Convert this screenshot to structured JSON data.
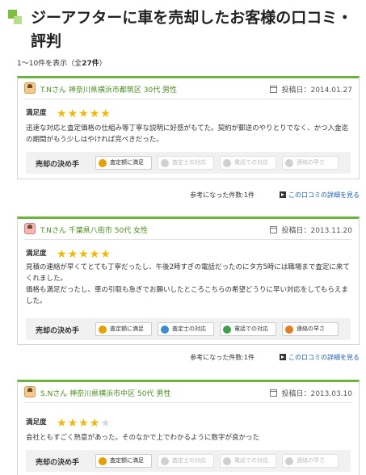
{
  "page": {
    "title": "ジーアフターに車を売却したお客様の口コミ・評判",
    "result_prefix": "1〜10件を表示（全",
    "result_total": "27件",
    "result_suffix": "）"
  },
  "labels": {
    "satisfaction": "満足度",
    "decider_title": "売却の決め手",
    "chip_price": "査定額に満足",
    "chip_staff": "査定士の対応",
    "chip_phone": "電話での対応",
    "chip_contact": "連絡の早さ",
    "helpful_prefix": "参考になった件数:",
    "detail_link": "この口コミの詳細を見る"
  },
  "reviews": [
    {
      "reviewer": "T.Nさん 神奈川県横浜市都筑区 30代 男性",
      "gender": "male",
      "date": "投稿日：2014.01.27",
      "rating": 5,
      "comment": "迅速な対応と査定価格の仕組み等丁寧な説明に好感がもてた。契約が郵送のやりとりでなく、かつ入金迄の期間がもう少しはやければ完ぺきだった。",
      "chips": {
        "price": true,
        "staff": false,
        "phone": false,
        "contact": false
      },
      "helpful": "1件"
    },
    {
      "reviewer": "T.Nさん 千葉県八街市 50代 女性",
      "gender": "female",
      "date": "投稿日：2013.11.20",
      "rating": 5,
      "comment": "見積の連絡が早くてとても丁寧だったし、午後2時すぎの電話だったのにタ方5時には職場まで査定に来てくれました。\n価格も満足だったし、車の引取も急ぎでお願いしたところこちらの希望どうりに早い対応をしてもらえました。",
      "chips": {
        "price": true,
        "staff": true,
        "phone": true,
        "contact": true
      },
      "helpful": "1件"
    },
    {
      "reviewer": "S.Nさん 神奈川県横浜市中区 50代 男性",
      "gender": "male",
      "date": "投稿日：2013.03.10",
      "rating": 4,
      "comment": "会社ともすごく熱意があった。そのなかで上でわかるように数字が良かった",
      "chips": {
        "price": true,
        "staff": false,
        "phone": false,
        "contact": false
      },
      "helpful": ""
    }
  ]
}
